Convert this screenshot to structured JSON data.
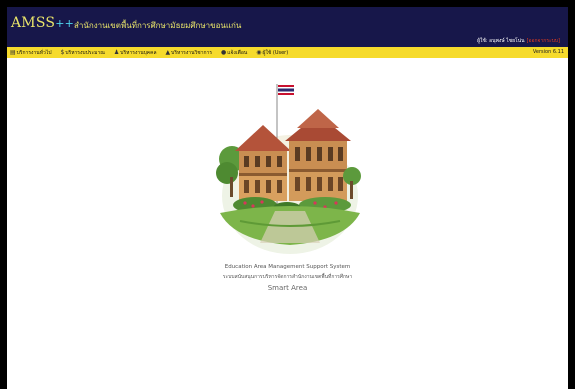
{
  "header": {
    "logo_text": "AMSS",
    "logo_plus": "++",
    "office_name": "สำนักงานเขตพื้นที่การศึกษามัธยมศึกษาขอนแก่น",
    "user_text": "ผู้ใช้: อนุพงษ์ ไชยโน่น",
    "logout_text": "[ออกจากระบบ]"
  },
  "menu": {
    "items": [
      {
        "label": "บริการงานทั่วไป",
        "icon": "document-icon"
      },
      {
        "label": "บริหารงบประมาณ",
        "icon": "money-icon"
      },
      {
        "label": "บริหารงานบุคคล",
        "icon": "user-icon"
      },
      {
        "label": "บริหารงานวิชาการ",
        "icon": "graduation-cap-icon"
      },
      {
        "label": "แจ้งเตือน",
        "icon": "bell-icon"
      },
      {
        "label": "ผู้ใช้ (User)",
        "icon": "user-circle-icon"
      }
    ],
    "version": "Version 6.11"
  },
  "content": {
    "caption_en": "Education Area Management Support System",
    "caption_th": "ระบบสนับสนุนการบริหารจัดการสำนักงานเขตพื้นที่การศึกษา",
    "link_text": "Smart Area"
  },
  "colors": {
    "header_bg": "#17174a",
    "menubar_bg": "#f6db2c",
    "logo": "#e9e46a",
    "accent_plus": "#4fd6ee",
    "logout": "#e53b1e"
  }
}
